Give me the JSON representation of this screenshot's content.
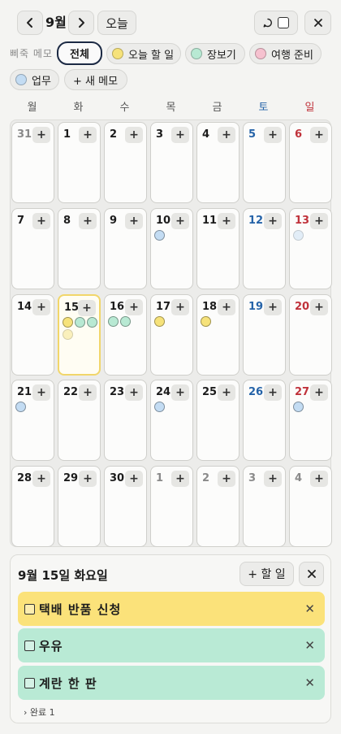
{
  "header": {
    "month_title": "9월",
    "today_label": "오늘",
    "prev_icon": "chevron-left-icon",
    "next_icon": "chevron-right-icon",
    "close_icon": "close-icon"
  },
  "memo": {
    "label": "삐죽 메모",
    "chips": [
      {
        "label": "전체",
        "color": ""
      },
      {
        "label": "오늘 할 일",
        "color": "#f6e27a"
      },
      {
        "label": "장보기",
        "color": "#b8e9d3"
      },
      {
        "label": "여행 준비",
        "color": "#f6c1cf"
      },
      {
        "label": "업무",
        "color": "#c3dcf3"
      }
    ],
    "new_memo_label": "+ 새 메모"
  },
  "weekdays": [
    "월",
    "화",
    "수",
    "목",
    "금",
    "토",
    "일"
  ],
  "calendar": {
    "add_label": "+",
    "colors": {
      "yellow": "#f6e27a",
      "green": "#b8e9d3",
      "blue": "#c3dcf3",
      "pink": "#f6c1cf"
    },
    "weeks": [
      [
        {
          "day": "31",
          "other": true
        },
        {
          "day": "1"
        },
        {
          "day": "2"
        },
        {
          "day": "3"
        },
        {
          "day": "4"
        },
        {
          "day": "5"
        },
        {
          "day": "6"
        }
      ],
      [
        {
          "day": "7"
        },
        {
          "day": "8"
        },
        {
          "day": "9"
        },
        {
          "day": "10",
          "dots": [
            "blue"
          ]
        },
        {
          "day": "11"
        },
        {
          "day": "12"
        },
        {
          "day": "13",
          "dots": [
            "blue-faded"
          ]
        }
      ],
      [
        {
          "day": "14"
        },
        {
          "day": "15",
          "today": true,
          "dots": [
            "yellow",
            "green",
            "green",
            "yellow-faded"
          ]
        },
        {
          "day": "16",
          "dots": [
            "green",
            "green"
          ]
        },
        {
          "day": "17",
          "dots": [
            "yellow"
          ]
        },
        {
          "day": "18",
          "dots": [
            "yellow"
          ]
        },
        {
          "day": "19"
        },
        {
          "day": "20"
        }
      ],
      [
        {
          "day": "21",
          "dots": [
            "blue"
          ]
        },
        {
          "day": "22"
        },
        {
          "day": "23"
        },
        {
          "day": "24",
          "dots": [
            "blue"
          ]
        },
        {
          "day": "25"
        },
        {
          "day": "26"
        },
        {
          "day": "27",
          "dots": [
            "blue"
          ]
        }
      ],
      [
        {
          "day": "28"
        },
        {
          "day": "29"
        },
        {
          "day": "30"
        },
        {
          "day": "1",
          "other": true
        },
        {
          "day": "2",
          "other": true
        },
        {
          "day": "3",
          "other": true
        },
        {
          "day": "4",
          "other": true
        }
      ]
    ]
  },
  "detail": {
    "title": "9월 15일 화요일",
    "add_task_label": "+ 할 일",
    "tasks": [
      {
        "label": "택배 반품 신청",
        "color": "#fbe27a"
      },
      {
        "label": "우유",
        "color": "#b9ead5"
      },
      {
        "label": "계란 한 판",
        "color": "#b9ead5"
      }
    ],
    "delete_label": "✕",
    "done_label": "› 완료 1"
  }
}
